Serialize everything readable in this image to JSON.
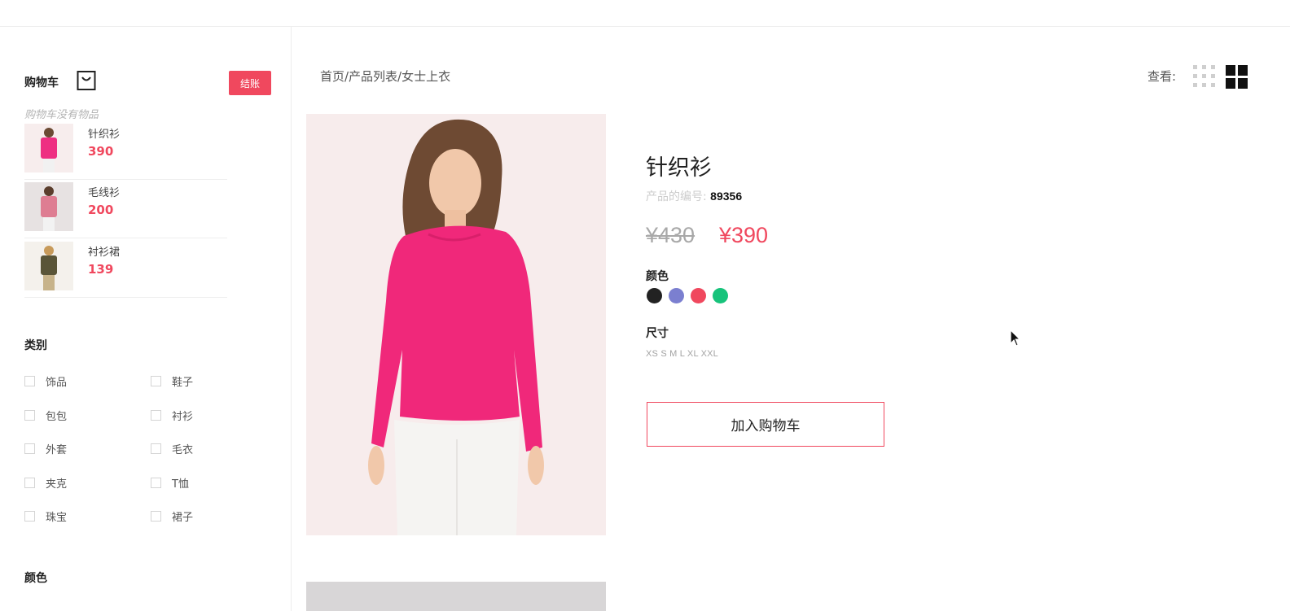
{
  "cart": {
    "title": "购物车",
    "checkout_label": "结账",
    "empty_text": "购物车没有物品",
    "items": [
      {
        "name": "针织衫",
        "price": "390",
        "thumb_color": "#ee2f82"
      },
      {
        "name": "毛线衫",
        "price": "200",
        "thumb_color": "#de7d92"
      },
      {
        "name": "衬衫裙",
        "price": "139",
        "thumb_color": "#5a5538"
      }
    ]
  },
  "filters": {
    "category_title": "类别",
    "categories": [
      "饰品",
      "鞋子",
      "包包",
      "衬衫",
      "外套",
      "毛衣",
      "夹克",
      "T恤",
      "珠宝",
      "裙子"
    ],
    "color_title": "颜色"
  },
  "breadcrumb": "首页/产品列表/女士上衣",
  "view": {
    "label": "查看:",
    "icons": [
      "grid-small-icon",
      "grid-large-icon"
    ]
  },
  "product": {
    "title": "针织衫",
    "sku_label": "产品的编号:",
    "sku_value": "89356",
    "old_price": "¥430",
    "new_price": "¥390",
    "color_title": "颜色",
    "colors": [
      "#222222",
      "#7b7fd0",
      "#f0485e",
      "#17c37b"
    ],
    "size_title": "尺寸",
    "sizes": "XS S M L XL XXL",
    "add_to_cart_label": "加入购物车"
  },
  "colors": {
    "accent": "#f0485e",
    "product_pink": "#f0287a"
  }
}
